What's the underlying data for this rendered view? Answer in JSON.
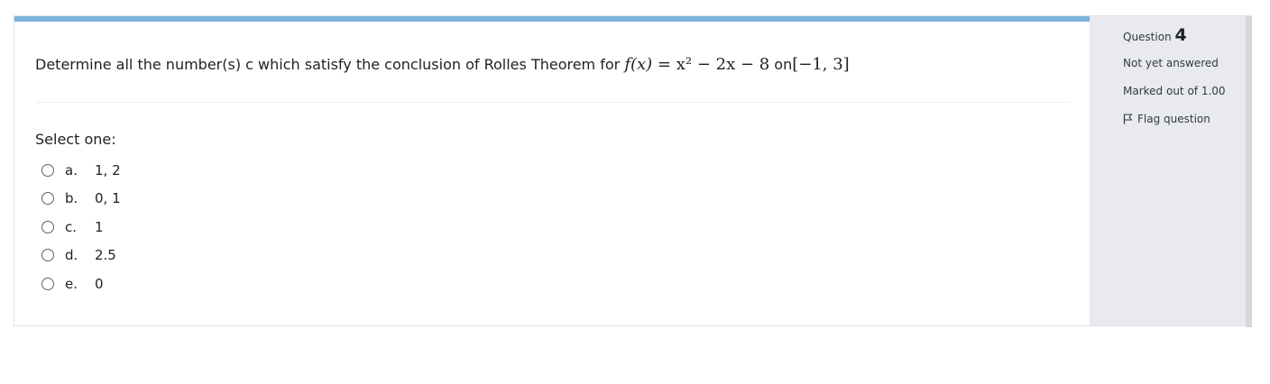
{
  "question": {
    "text_prefix": "Determine all the number(s) c which satisfy the conclusion of Rolles Theorem for",
    "formula_fx": "f(x)",
    "formula_rhs": "= x² − 2x − 8",
    "connector": "on",
    "interval": "[−1, 3]",
    "prompt": "Select one:",
    "answers": [
      {
        "letter": "a.",
        "value": "1, 2"
      },
      {
        "letter": "b.",
        "value": "0, 1"
      },
      {
        "letter": "c.",
        "value": "1"
      },
      {
        "letter": "d.",
        "value": "2.5"
      },
      {
        "letter": "e.",
        "value": "0"
      }
    ]
  },
  "info": {
    "question_label": "Question",
    "question_number": "4",
    "status": "Not yet answered",
    "marks": "Marked out of 1.00",
    "flag_label": "Flag question",
    "flag_icon": "flag-icon"
  },
  "colors": {
    "topbar": "#7cb4dc",
    "info_panel": "#e8eaed"
  }
}
